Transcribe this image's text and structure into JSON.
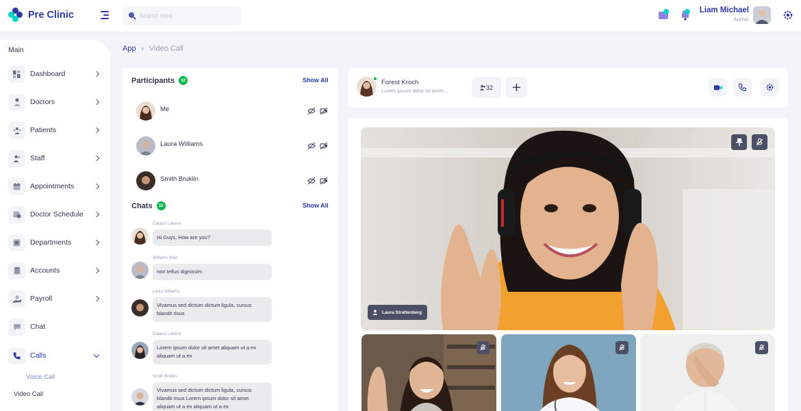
{
  "app": {
    "name": "Pre Clinic"
  },
  "search": {
    "placeholder": "Search here"
  },
  "user": {
    "name": "Liam Michael",
    "role": "Admin"
  },
  "breadcrumb": {
    "parent": "App",
    "current": "Video Call"
  },
  "sidebar": {
    "heading": "Main",
    "items": [
      {
        "label": "Dashboard",
        "icon": "dashboard-icon"
      },
      {
        "label": "Doctors",
        "icon": "doctor-icon"
      },
      {
        "label": "Patients",
        "icon": "patients-icon"
      },
      {
        "label": "Staff",
        "icon": "staff-icon"
      },
      {
        "label": "Appointments",
        "icon": "calendar-icon"
      },
      {
        "label": "Doctor Schedule",
        "icon": "schedule-icon"
      },
      {
        "label": "Departments",
        "icon": "department-icon"
      },
      {
        "label": "Accounts",
        "icon": "accounts-icon"
      },
      {
        "label": "Payroll",
        "icon": "payroll-icon"
      },
      {
        "label": "Chat",
        "icon": "chat-icon"
      },
      {
        "label": "Calls",
        "icon": "phone-icon"
      }
    ],
    "sub_items": [
      "Voice Call",
      "Video Call"
    ]
  },
  "participants": {
    "title": "Participants",
    "count": "32",
    "show_all": "Show All",
    "list": [
      {
        "name": "Me"
      },
      {
        "name": "Laura Williams"
      },
      {
        "name": "Smith Bruklin"
      }
    ]
  },
  "chats": {
    "title": "Chats",
    "count": "32",
    "show_all": "Show All",
    "messages": [
      {
        "author": "Galaviz Lalema",
        "text": "Hi Guys, How are you?"
      },
      {
        "author": "Williams Bruk",
        "text": "non tellus dignissim"
      },
      {
        "author": "Laura Williams",
        "text": "Vivamus sed dictum dictum ligula, cursus blandit risus"
      },
      {
        "author": "Galaviz Lalema",
        "text": "Lorem ipsum dolor sit amet aliquam ut a ex aliquam ut a ex"
      },
      {
        "author": "Smith Bruklin",
        "text": "Vivamus sed dictum dictum ligula, cursus blandit risus Lorem ipsum dolor sit amet aliquam ut a ex aliquam ut a ex"
      }
    ]
  },
  "call": {
    "name": "Forest Kroch",
    "subtitle": "Lorem ipsum dolor sit amet...",
    "participants_count": "32",
    "main_speaker": "Laura Strattenberg"
  },
  "colors": {
    "primary": "#2e37a4",
    "accent": "#00d3c7",
    "online": "#00b548"
  }
}
